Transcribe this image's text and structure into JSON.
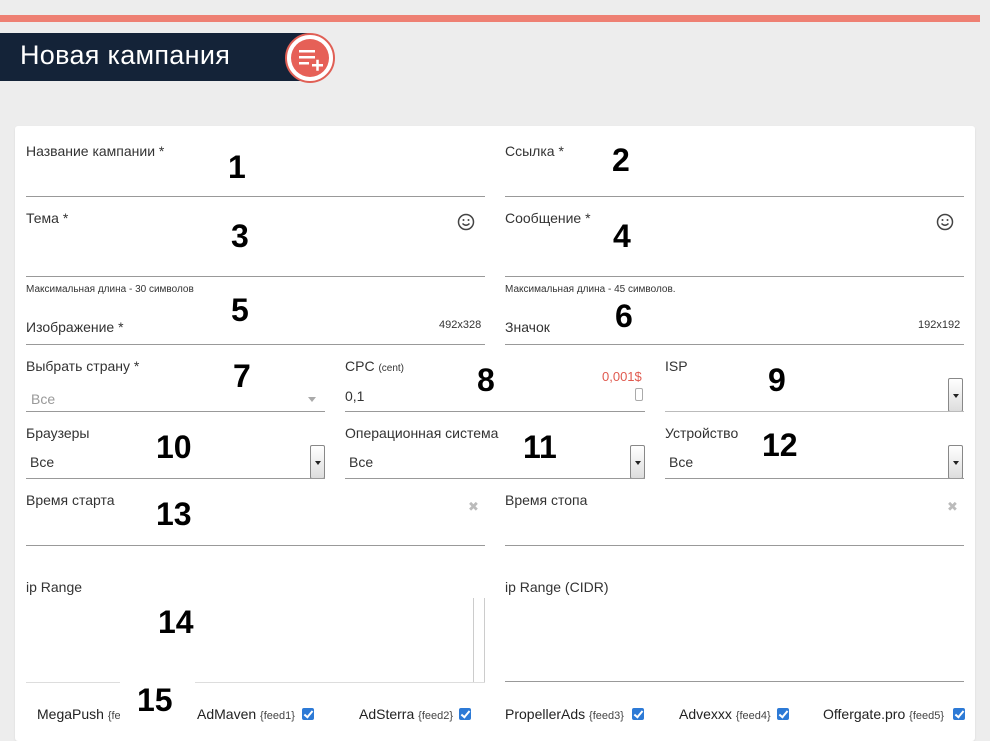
{
  "header": {
    "title": "Новая кампания",
    "icon": "add-list-icon"
  },
  "fields": {
    "campaign_name": {
      "label": "Название кампании *",
      "marker": "1"
    },
    "link": {
      "label": "Ссылка *",
      "marker": "2"
    },
    "subject": {
      "label": "Тема *",
      "marker": "3",
      "hint": "Максимальная длина - 30 символов"
    },
    "message": {
      "label": "Сообщение *",
      "marker": "4",
      "hint": "Максимальная длина - 45 символов."
    },
    "image": {
      "label": "Изображение *",
      "marker": "5",
      "size": "492x328"
    },
    "icon": {
      "label": "Значок",
      "marker": "6",
      "size": "192x192"
    },
    "country": {
      "label": "Выбрать страну *",
      "marker": "7",
      "value": "Все"
    },
    "cpc": {
      "label": "CPC",
      "unit": "(cent)",
      "marker": "8",
      "value": "0,1",
      "price": "0,001$"
    },
    "isp": {
      "label": "ISP",
      "marker": "9"
    },
    "browsers": {
      "label": "Браузеры",
      "marker": "10",
      "value": "Все"
    },
    "os": {
      "label": "Операционная система",
      "marker": "11",
      "value": "Все"
    },
    "device": {
      "label": "Устройство",
      "marker": "12",
      "value": "Все"
    },
    "start_time": {
      "label": "Время старта",
      "marker": "13"
    },
    "stop_time": {
      "label": "Время стопа"
    },
    "ip_range": {
      "label": "ip Range",
      "marker": "14"
    },
    "ip_range_cidr": {
      "label": "ip Range (CIDR)"
    }
  },
  "feeds": {
    "marker": "15",
    "items": [
      {
        "name": "MegaPush",
        "tag": "{fe",
        "checked": true
      },
      {
        "name": "AdMaven",
        "tag": "{feed1}",
        "checked": true
      },
      {
        "name": "AdSterra",
        "tag": "{feed2}",
        "checked": true
      },
      {
        "name": "PropellerAds",
        "tag": "{feed3}",
        "checked": true
      },
      {
        "name": "Advexxx",
        "tag": "{feed4}",
        "checked": true
      },
      {
        "name": "Offergate.pro",
        "tag": "{feed5}",
        "checked": true
      }
    ]
  },
  "colors": {
    "accent": "#ee8073",
    "header_bg": "#142338",
    "price": "#e05a4f",
    "checkbox": "#2d7ad6"
  }
}
